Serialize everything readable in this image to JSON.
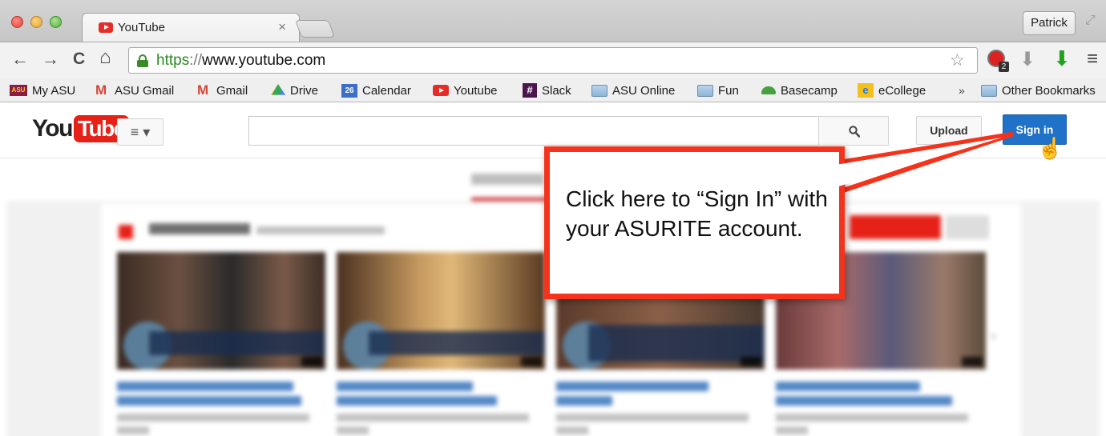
{
  "browser": {
    "tab_title": "YouTube",
    "tab_close": "×",
    "profile": "Patrick",
    "url_scheme": "https",
    "url_separator": "://",
    "url_host": "www.youtube.com",
    "stop_badge": "2",
    "nav": {
      "back": "←",
      "forward": "→",
      "reload": "C",
      "home": "⌂"
    },
    "star": "☆",
    "menu": "≡",
    "download_gray": "⬇",
    "download_green": "⬇",
    "expand": "⤢"
  },
  "bookmarks": {
    "items": [
      {
        "label": "My ASU",
        "icon": "asu-icon",
        "badge": "ASU"
      },
      {
        "label": "ASU Gmail",
        "icon": "gmail-icon",
        "badge": "M"
      },
      {
        "label": "Gmail",
        "icon": "gmail-icon",
        "badge": "M"
      },
      {
        "label": "Drive",
        "icon": "drive-icon",
        "badge": ""
      },
      {
        "label": "Calendar",
        "icon": "calendar-icon",
        "badge": "26"
      },
      {
        "label": "Youtube",
        "icon": "youtube-icon",
        "badge": ""
      },
      {
        "label": "Slack",
        "icon": "slack-icon",
        "badge": "#"
      },
      {
        "label": "ASU Online",
        "icon": "folder-icon",
        "badge": ""
      },
      {
        "label": "Fun",
        "icon": "folder-icon",
        "badge": ""
      },
      {
        "label": "Basecamp",
        "icon": "basecamp-icon",
        "badge": ""
      },
      {
        "label": "eCollege",
        "icon": "ecollege-icon",
        "badge": "e"
      }
    ],
    "overflow": "»",
    "other": "Other Bookmarks"
  },
  "youtube": {
    "logo_you": "You",
    "logo_tube": "Tube",
    "guide": "≡ ▾",
    "upload": "Upload",
    "sign_in": "Sign in"
  },
  "callout": {
    "text": "Click here to “Sign In” with your ASURITE account."
  },
  "colors": {
    "youtube_red": "#e62117",
    "signin_blue": "#1f72c8",
    "callout_red": "#f5331c",
    "https_green": "#2a8a24"
  }
}
